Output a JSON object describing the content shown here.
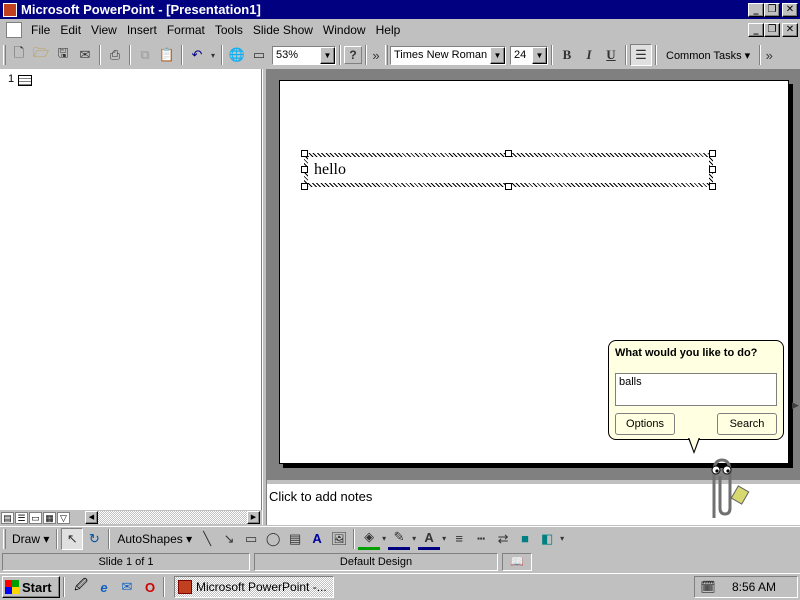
{
  "window": {
    "title": "Microsoft PowerPoint - [Presentation1]",
    "caption_buttons": [
      "_",
      "❐",
      "✕"
    ]
  },
  "menu": {
    "items": [
      "File",
      "Edit",
      "View",
      "Insert",
      "Format",
      "Tools",
      "Slide Show",
      "Window",
      "Help"
    ],
    "doc_caption_buttons": [
      "_",
      "❐",
      "✕"
    ]
  },
  "toolbar": {
    "zoom": "53%",
    "help": "?",
    "overflow": "»",
    "font_name": "Times New Roman",
    "font_size": "24",
    "bold": "B",
    "italic": "I",
    "underline": "U",
    "common_tasks": "Common Tasks ▾"
  },
  "outline": {
    "slide_number": "1"
  },
  "slide": {
    "title_text": "hello"
  },
  "notes": {
    "placeholder": "Click to add notes"
  },
  "drawing": {
    "draw_label": "Draw ▾",
    "autoshapes_label": "AutoShapes ▾"
  },
  "status": {
    "slide": "Slide 1 of 1",
    "design": "Default Design"
  },
  "assistant": {
    "question": "What would you like to do?",
    "query": "balls",
    "options_label": "Options",
    "search_label": "Search"
  },
  "taskbar": {
    "start_label": "Start",
    "task_label": "Microsoft PowerPoint -...",
    "clock": "8:56 AM"
  },
  "colors": {
    "titlebar": "#000080",
    "balloon": "#ffffe1",
    "face": "#c0c0c0"
  }
}
